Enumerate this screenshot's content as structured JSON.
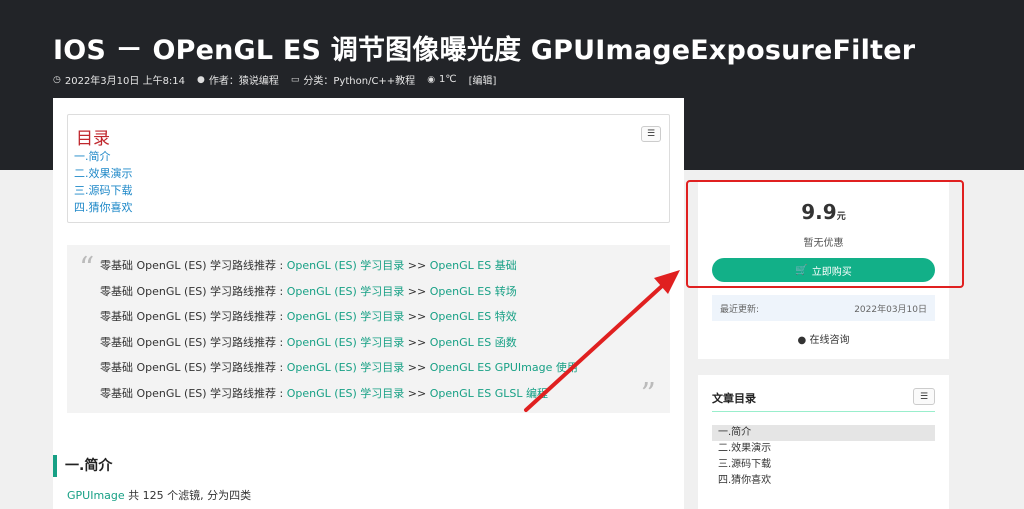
{
  "post": {
    "title": "IOS － OPenGL ES 调节图像曝光度 GPUImageExposureFilter",
    "meta": {
      "date": "2022年3月10日 上午8:14",
      "author": "作者：猿说编程",
      "category": "分类：Python/C++教程",
      "views": "1℃",
      "edit": "[编辑]"
    }
  },
  "toc": {
    "title": "目录",
    "items": [
      "一.简介",
      "二.效果演示",
      "三.源码下载",
      "四.猜你喜欢"
    ]
  },
  "quote": {
    "open_mark": "“",
    "close_mark": "”",
    "prefix": "零基础 OpenGL (ES) 学习路线推荐 : ",
    "link1": "OpenGL (ES) 学习目录",
    "sep": " >> ",
    "lines": [
      "OpenGL ES 基础",
      "OpenGL ES 转场",
      "OpenGL ES 特效",
      "OpenGL ES 函数",
      "OpenGL ES GPUImage 使用",
      "OpenGL ES GLSL 编程"
    ]
  },
  "section": {
    "heading": "一.简介",
    "para_link": "GPUImage",
    "para_text": " 共 125 个滤镜, 分为四类"
  },
  "buy": {
    "price": "9.9",
    "unit": "元",
    "no_discount": "暂无优惠",
    "button": "立即购买",
    "update_label": "最近更新:",
    "update_date": "2022年03月10日",
    "consult": "在线咨询"
  },
  "side_toc": {
    "title": "文章目录",
    "items": [
      "一.简介",
      "二.效果演示",
      "三.源码下载",
      "四.猜你喜欢"
    ]
  },
  "colors": {
    "accent": "#17a085",
    "button": "#12b088",
    "highlight": "#e02020",
    "hero": "#222428"
  }
}
